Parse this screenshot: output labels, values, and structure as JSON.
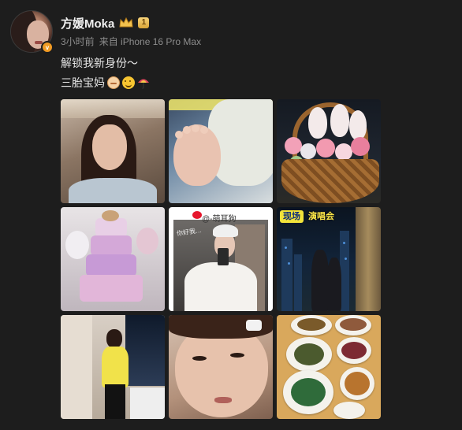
{
  "post": {
    "author": {
      "name": "方媛Moka",
      "vip_level": "1",
      "verified_mark": "v"
    },
    "meta": {
      "time": "3小时前",
      "source": "来自 iPhone 16 Pro Max"
    },
    "content": {
      "line1": "解锁我新身份～",
      "line2": "三胎宝妈"
    },
    "emojis": [
      "baby-emoji",
      "smile-emoji",
      "umbrella-emoji"
    ],
    "images": [
      {
        "id": "selfie-bedroom"
      },
      {
        "id": "baby-foot"
      },
      {
        "id": "flower-basket-bunnies"
      },
      {
        "id": "tiered-cake"
      },
      {
        "id": "mirror-selfie-watermarked",
        "watermark": "@-萌耳狗",
        "tag": "你好我…"
      },
      {
        "id": "concert-window",
        "live_label": "现场",
        "live_text": "演唱会"
      },
      {
        "id": "yellow-top-mirror"
      },
      {
        "id": "closeup-face"
      },
      {
        "id": "meal-table"
      }
    ]
  },
  "colors": {
    "background": "#1d1d1d",
    "vip_gold": "#d9a537",
    "verified_orange": "#f29b24",
    "meta_gray": "#8d8d8d"
  }
}
